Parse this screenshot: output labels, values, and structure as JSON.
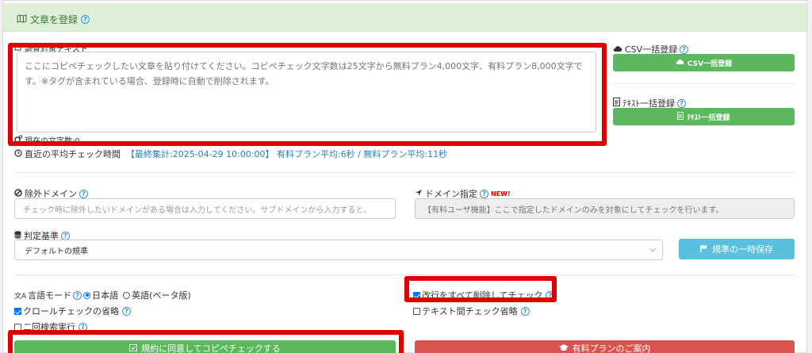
{
  "header": {
    "title": "文章を登録"
  },
  "target_text": {
    "label": "調査対象テキスト",
    "placeholder": "ここにコピペチェックしたい文章を貼り付けてください。コピペチェック文字数は25文字から無料プラン4,000文字、有料プラン8,000文字です。※タグが含まれている場合、登録時に自動で削除されます。",
    "char_count_label": "現在の文字数:0"
  },
  "csv": {
    "label": "CSV一括登録",
    "button": "CSV一括登録"
  },
  "text_bulk": {
    "label": "ﾃｷｽﾄ一括登録",
    "button": "ﾃｷｽﾄ一括登録"
  },
  "avg_time": {
    "label": "直近の平均チェック時間",
    "summary": "【最終集計:2025-04-29 10:00:00】 有料プラン平均:6秒 / 無料プラン平均:11秒"
  },
  "exclude_domain": {
    "label": "除外ドメイン",
    "placeholder": "チェック時に除外したいドメインがある場合は入力してください。サブドメインから入力すると、"
  },
  "domain_spec": {
    "label": "ドメイン指定",
    "badge": "NEW!",
    "placeholder": "【有料ユーザ機能】ここで指定したドメインのみを対象にしてチェックを行います。"
  },
  "criteria": {
    "label": "判定基準",
    "selected": "デフォルトの規準",
    "save_button": "規準の一時保存"
  },
  "options": {
    "language_label": "言語モード",
    "lang_ja": "日本語",
    "lang_en": "英語(ベータ版)",
    "skip_crawl": "クロールチェックの省略",
    "second_search": "二回検索実行",
    "remove_newlines": "改行をすべて削除してチェック",
    "skip_text_diff": "テキスト間チェック省略"
  },
  "actions": {
    "agree_check": "規約に同意してコピペチェックする",
    "paid_plan": "有料プランのご案内"
  },
  "colors": {
    "highlight": "#e00000",
    "success": "#5cb85c",
    "info": "#5bc0de",
    "danger": "#d9534f",
    "header_bg": "#dff0d8",
    "link": "#2a7fbf"
  }
}
